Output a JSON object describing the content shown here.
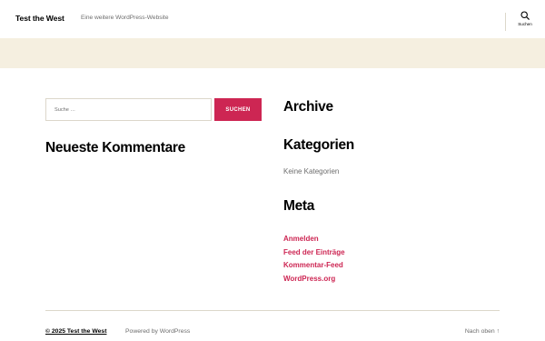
{
  "header": {
    "site_title": "Test the West",
    "site_description": "Eine weitere WordPress-Website",
    "search_toggle_label": "Suchen"
  },
  "sidebar_left": {
    "search": {
      "placeholder": "Suche …",
      "value": "",
      "submit_label": "SUCHEN"
    },
    "recent_comments_title": "Neueste Kommentare"
  },
  "sidebar_right": {
    "archive_title": "Archive",
    "categories_title": "Kategorien",
    "categories_empty": "Keine Kategorien",
    "meta_title": "Meta",
    "meta_links": [
      {
        "label": "Anmelden"
      },
      {
        "label": "Feed der Einträge"
      },
      {
        "label": "Kommentar-Feed"
      },
      {
        "label": "WordPress.org"
      }
    ]
  },
  "footer": {
    "copyright": "© 2025 Test the West",
    "powered_by": "Powered by WordPress",
    "to_top": "Nach oben ↑"
  },
  "colors": {
    "accent": "#cd2653",
    "banner_background": "#f5efe0",
    "secondary_text": "#6d6d6d",
    "border": "#dcd7ca"
  },
  "icons": {
    "search_toggle": "search-icon"
  }
}
